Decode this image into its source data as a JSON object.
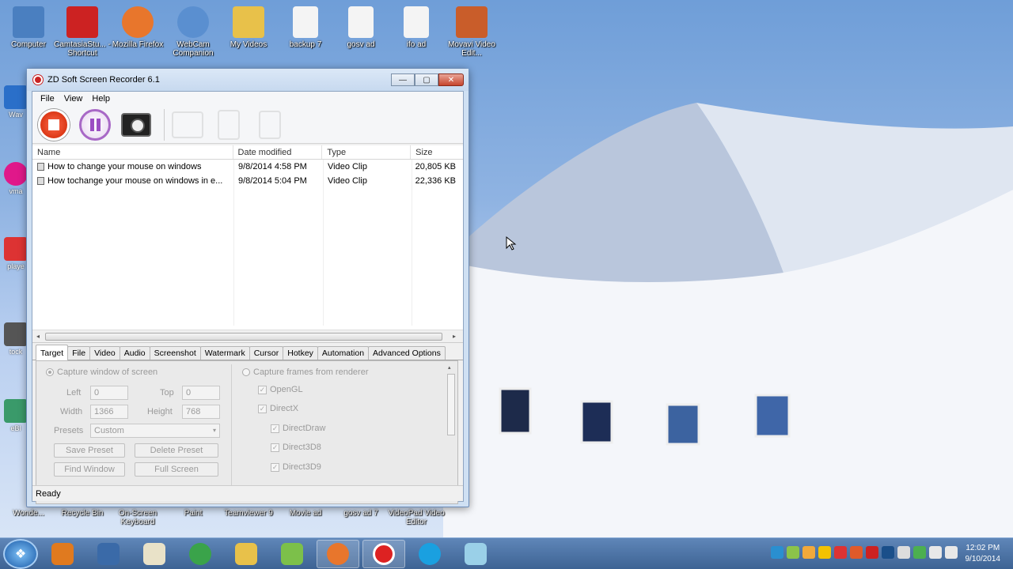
{
  "desktop": {
    "top_icons": [
      {
        "label": "Computer",
        "icon": "computer-icon",
        "color": "#4a7fc0"
      },
      {
        "label": "CamtasiaStu... - Shortcut",
        "icon": "camtasia-icon",
        "color": "#c22"
      },
      {
        "label": "Mozilla Firefox",
        "icon": "firefox-icon",
        "color": "#e8762c"
      },
      {
        "label": "WebCam Companion",
        "icon": "webcam-icon",
        "color": "#5a8fd0"
      },
      {
        "label": "My Videos",
        "icon": "folder-icon",
        "color": "#e8c14a"
      },
      {
        "label": "backup 7",
        "icon": "file-icon",
        "color": "#f4f4f4"
      },
      {
        "label": "gosv ad",
        "icon": "file-icon",
        "color": "#f4f4f4"
      },
      {
        "label": "ifo ad",
        "icon": "file-icon",
        "color": "#f4f4f4"
      },
      {
        "label": "Movavi Video Edit...",
        "icon": "movavi-icon",
        "color": "#c95d2a"
      }
    ],
    "left_icons": [
      {
        "label": "Wav",
        "icon": "wave-icon",
        "color": "#2a6fc9"
      },
      {
        "label": "vma",
        "icon": "app-icon",
        "color": "#e0188a"
      },
      {
        "label": "playe",
        "icon": "pdf-icon",
        "color": "#d33"
      },
      {
        "label": "tock",
        "icon": "photo-icon",
        "color": "#555"
      },
      {
        "label": "eBl",
        "icon": "app-icon",
        "color": "#3a9a6a"
      }
    ],
    "bottom_icons": [
      {
        "label": "Wonde..."
      },
      {
        "label": "Recycle Bin"
      },
      {
        "label": "On-Screen Keyboard"
      },
      {
        "label": "Paint"
      },
      {
        "label": "Teamviewer 9"
      },
      {
        "label": "Movie ad"
      },
      {
        "label": "gosv ad 7"
      },
      {
        "label": "VideoPad Video Editor"
      }
    ]
  },
  "window": {
    "title": "ZD Soft Screen Recorder 6.1",
    "title_buttons": [
      "—",
      "▢",
      "✕"
    ],
    "menu": [
      "File",
      "View",
      "Help"
    ],
    "toolbar": {
      "record": "stop-record-button",
      "pause": "pause-button",
      "snapshot": "camera-icon"
    },
    "list": {
      "columns": [
        "Name",
        "Date modified",
        "Type",
        "Size"
      ],
      "rows": [
        {
          "name": "How to change your mouse on windows",
          "date": "9/8/2014 4:58 PM",
          "type": "Video Clip",
          "size": "20,805 KB"
        },
        {
          "name": "How tochange your mouse on windows in e...",
          "date": "9/8/2014 5:04 PM",
          "type": "Video Clip",
          "size": "22,336 KB"
        }
      ]
    },
    "tabs": [
      "Target",
      "File",
      "Video",
      "Audio",
      "Screenshot",
      "Watermark",
      "Cursor",
      "Hotkey",
      "Automation",
      "Advanced Options"
    ],
    "target": {
      "capture_window": "Capture window of screen",
      "left_label": "Left",
      "left_value": "0",
      "top_label": "Top",
      "top_value": "0",
      "width_label": "Width",
      "width_value": "1366",
      "height_label": "Height",
      "height_value": "768",
      "presets_label": "Presets",
      "presets_value": "Custom",
      "save_preset": "Save Preset",
      "delete_preset": "Delete Preset",
      "find_window": "Find Window",
      "full_screen": "Full Screen",
      "capture_frames": "Capture frames from renderer",
      "renderers": [
        "OpenGL",
        "DirectX",
        "DirectDraw",
        "Direct3D8",
        "Direct3D9"
      ]
    },
    "status": "Ready"
  },
  "taskbar": {
    "clock_time": "12:02 PM",
    "clock_date": "9/10/2014",
    "pinned": [
      {
        "icon": "media-player-icon",
        "color": "#e07a1f"
      },
      {
        "icon": "computer-icon",
        "color": "#3a6aa8"
      },
      {
        "icon": "paint-icon",
        "color": "#e9e2c8"
      },
      {
        "icon": "chrome-icon",
        "color": "#3aa34a"
      },
      {
        "icon": "explorer-icon",
        "color": "#e8c14a"
      },
      {
        "icon": "notepad-icon",
        "color": "#7cc04a"
      },
      {
        "icon": "firefox-icon",
        "color": "#e8762c"
      },
      {
        "icon": "screen-recorder-icon",
        "color": "#d22"
      },
      {
        "icon": "skype-icon",
        "color": "#1aa0e0"
      },
      {
        "icon": "disk-icon",
        "color": "#9ad0e8"
      }
    ]
  }
}
